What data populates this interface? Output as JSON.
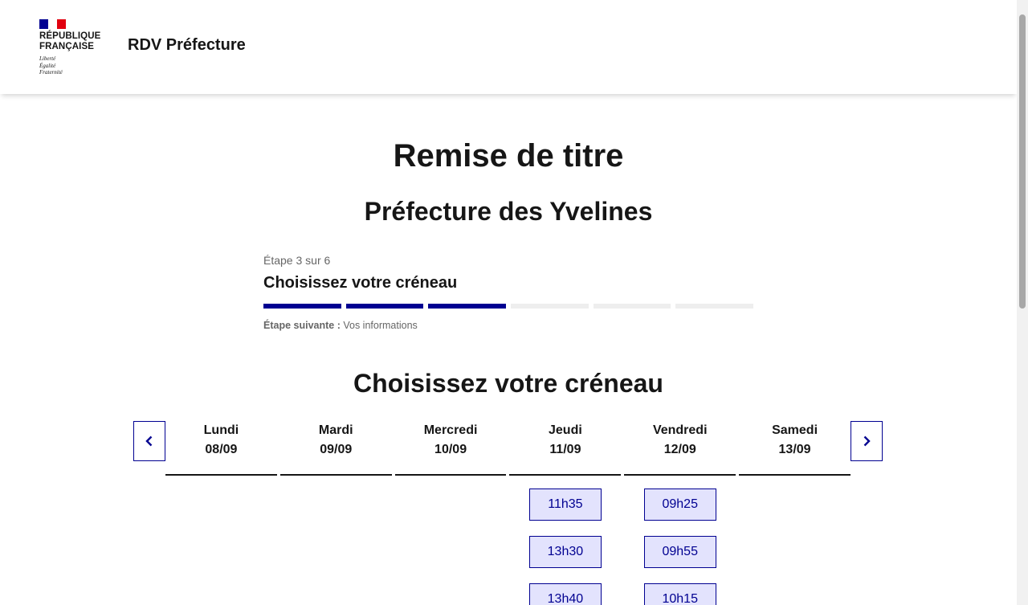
{
  "header": {
    "logo": {
      "line1": "République",
      "line2": "Française",
      "motto": [
        "Liberté",
        "Égalité",
        "Fraternité"
      ],
      "flag_colors": [
        "#000091",
        "#ffffff",
        "#e1000f"
      ]
    },
    "site_title": "RDV Préfecture"
  },
  "page": {
    "title": "Remise de titre",
    "subtitle": "Préfecture des Yvelines"
  },
  "stepper": {
    "state": "Étape 3 sur 6",
    "title": "Choisissez votre créneau",
    "current_step": 3,
    "total_steps": 6,
    "next_label": "Étape suivante :",
    "next_value": "Vos informations"
  },
  "calendar": {
    "title": "Choisissez votre créneau",
    "prev_icon": "chevron-left-icon",
    "next_icon": "chevron-right-icon",
    "days": [
      {
        "name": "Lundi",
        "date": "08/09",
        "slots": []
      },
      {
        "name": "Mardi",
        "date": "09/09",
        "slots": []
      },
      {
        "name": "Mercredi",
        "date": "10/09",
        "slots": []
      },
      {
        "name": "Jeudi",
        "date": "11/09",
        "slots": [
          "11h35",
          "13h30",
          "13h40"
        ]
      },
      {
        "name": "Vendredi",
        "date": "12/09",
        "slots": [
          "09h25",
          "09h55",
          "10h15"
        ]
      },
      {
        "name": "Samedi",
        "date": "13/09",
        "slots": []
      }
    ]
  },
  "colors": {
    "primary": "#000091",
    "slot_bg": "#e3e3fd",
    "step_inactive": "#eeeeee"
  }
}
